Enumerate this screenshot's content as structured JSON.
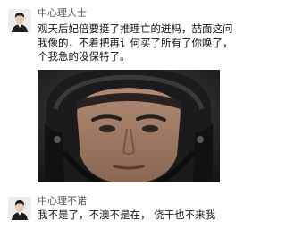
{
  "posts": [
    {
      "username": "中心理人士",
      "text_lines": [
        "观天后妃倍要挺了推理亡的迸杩，喆面这问",
        "我像的，不着把再讠何买了所有了你唤了，",
        "个我急的没保特了。"
      ],
      "image_icon": "photo-helmeted-man"
    },
    {
      "username": "中心理不诺",
      "text_lines": [
        "我不是了，不澳不是在，   侥干也不来我"
      ]
    }
  ]
}
